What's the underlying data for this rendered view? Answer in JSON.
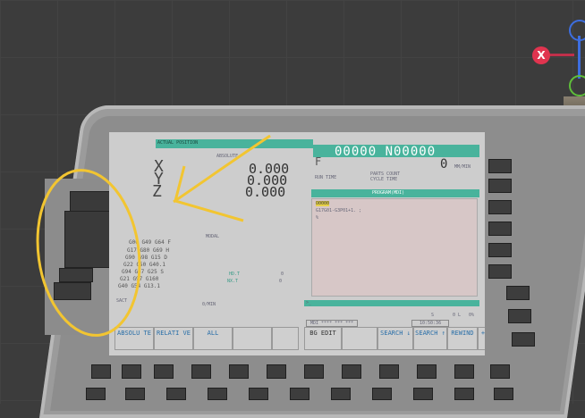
{
  "gizmo": {
    "x_label": "X"
  },
  "screen": {
    "header_left": "ACTUAL POSITION",
    "absolute_label": "ABSOLUTE",
    "program_header": "00000 N00000",
    "axes": [
      {
        "name": "X",
        "value": "0.000"
      },
      {
        "name": "Y",
        "value": "0.000"
      },
      {
        "name": "Z",
        "value": "0.000"
      }
    ],
    "f_label": "F",
    "f_value": "0",
    "f_unit": "MM/MIN",
    "run_time": "RUN TIME",
    "parts_count": "PARTS COUNT",
    "cycle_time": "CYCLE TIME",
    "program_mdi": "PROGRAM(MDI)",
    "prog_line1": "O0000",
    "prog_line2": "G17G01-G3P01+1. ;",
    "prog_line3": "%",
    "modal_label": "MODAL",
    "modal_rows": [
      "G00 G49 G64 F",
      "G17 G80 G69 H",
      "G90 G98 G15 D",
      "G22 G50 G40.1",
      "G94 G67 G25 S",
      "G21 G97 G160",
      "G40 G54 G13.1"
    ],
    "hd_t": "HD.T",
    "nx_t": "NX.T",
    "hd_val": "0",
    "nx_val": "0",
    "sact": "SACT",
    "sact_unit": "0/MIN",
    "prompt": ">_",
    "status_s": "S",
    "status_l": "0 L",
    "status_pct": "0%",
    "mode": "MDI **** *** ***",
    "clock": "10:50:36",
    "softkeys_left": [
      "ABSOLU TE",
      "RELATI VE",
      "ALL",
      "",
      ""
    ],
    "softkeys_right": [
      "BG EDIT",
      "",
      "SEARCH ↓",
      "SEARCH ↑",
      "REWIND",
      "+"
    ]
  },
  "colors": {
    "annotation": "#f2c531",
    "screen_teal": "#49b39c",
    "bezel": "#9b9b9b"
  }
}
